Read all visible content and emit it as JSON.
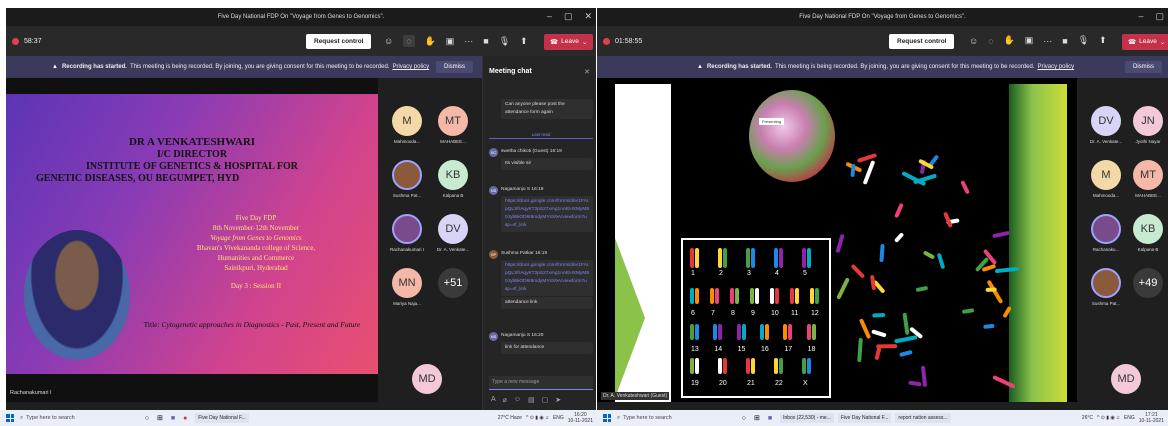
{
  "left": {
    "title": "Five Day National FDP On \"Voyage from Genes to Genomics\".",
    "timer": "58:37",
    "request_control": "Request control",
    "leave": "Leave",
    "banner": {
      "bold": "Recording has started.",
      "text": "This meeting is being recorded. By joining, you are giving consent for this meeting to be recorded.",
      "link": "Privacy policy",
      "dismiss": "Dismiss"
    },
    "slide": {
      "line1": "DR A VENKATESHWARI",
      "line2": "I/C DIRECTOR",
      "line3": "INSTITUTE OF GENETICS & HOSPITAL FOR",
      "line4": "GENETIC   DISEASES, OU BEGUMPET, HYD",
      "y1": "Five Day FDP",
      "y2": "8th November-12th November",
      "y3": "Voyage from Genes to Genomics",
      "y4": "Bhavan's Vivekananda college of Science,",
      "y5": "Humanities and Commerce",
      "y6": "Sainikpuri, Hyderabad",
      "y7": "Day 3 : Session II",
      "title_label": "Title:",
      "title_text": "Cytogenetic approaches in Diagnostics - Past, Present and Future"
    },
    "speaker": "Rachanakumari I",
    "participants": [
      {
        "initials": "M",
        "name": "Mahmooda...",
        "color": "#f4d9a8"
      },
      {
        "initials": "MT",
        "name": "MAHABEE...",
        "color": "#f3b8a8"
      },
      {
        "initials": "",
        "name": "Sushma Pat...",
        "color": "#8b5a3c"
      },
      {
        "initials": "KB",
        "name": "Kalpana B",
        "color": "#c7ead0"
      },
      {
        "initials": "",
        "name": "Rachanakumari I",
        "color": "#7a4b8a"
      },
      {
        "initials": "DV",
        "name": "Dr. A. Venkate...",
        "color": "#d8d4f5"
      },
      {
        "initials": "MN",
        "name": "Mariya Naja...",
        "color": "#f3b8a8"
      },
      {
        "initials": "+51",
        "name": "",
        "color": "#3a3a3a"
      },
      {
        "initials": "MD",
        "name": "",
        "color": "#f3c8d8"
      }
    ],
    "chat": {
      "header": "Meeting chat",
      "m0": "Can anyone please post the attendance form again",
      "last_read": "Last read",
      "m1_name": "swetha chikoti (Guest)",
      "m1_time": "16:19",
      "m1_text": "Its visible sir",
      "m2_name": "Nagamanju S",
      "m2_time": "16:19",
      "m2_link": "https://docs.google.com/forms/d/e/1FAIpQLSfrAqyKT2pS27xmg1nAEHXMyM80JybBiOD6I8mdyMYsX9A/viewform?usp=sf_link",
      "m3_name": "Sushma Patkar",
      "m3_time": "16:19",
      "m3_link": "https://docs.google.com/forms/d/e/1FAIpQLSfrAqyKT2pS27xmg1nAEHXMyM80JybBiOD6I8mdyMYsX9A/viewform?usp=sf_link",
      "m3_text": "attendance link",
      "m4_name": "Nagamanju S",
      "m4_time": "16:20",
      "m4_text": "link for attendance",
      "input_placeholder": "Type a new message"
    },
    "taskbar": {
      "search": "Type here to search",
      "app": "Five Day National F...",
      "weather": "27°C  Haze",
      "lang": "ENG",
      "time": "16:20",
      "date": "10-11-2021"
    }
  },
  "right": {
    "title": "Five Day National FDP On \"Voyage from Genes to Genomics\".",
    "timer": "01:58:55",
    "request_control": "Request control",
    "leave": "Leave",
    "banner": {
      "bold": "Recording has started.",
      "text": "This meeting is being recorded. By joining, you are giving consent for this meeting to be recorded.",
      "link": "Privacy policy",
      "dismiss": "Dismiss"
    },
    "presenting": "Presenting",
    "presenter_name": "Dr. A. Venkateshwari (Guest)",
    "karyotype_numbers": [
      "1",
      "2",
      "3",
      "4",
      "5",
      "6",
      "7",
      "8",
      "9",
      "10",
      "11",
      "12",
      "13",
      "14",
      "15",
      "16",
      "17",
      "18",
      "19",
      "20",
      "21",
      "22",
      "X"
    ],
    "participants": [
      {
        "initials": "DV",
        "name": "Dr. A. Venkate...",
        "color": "#d8d4f5"
      },
      {
        "initials": "JN",
        "name": "Jyothi Nayar",
        "color": "#f3c8d8"
      },
      {
        "initials": "M",
        "name": "Mahmooda...",
        "color": "#f4d9a8"
      },
      {
        "initials": "MT",
        "name": "MAHABEE...",
        "color": "#f3b8a8"
      },
      {
        "initials": "",
        "name": "Rachanaku...",
        "color": "#7a4b8a"
      },
      {
        "initials": "KB",
        "name": "Kalpana B",
        "color": "#c7ead0"
      },
      {
        "initials": "",
        "name": "Sushma Pat...",
        "color": "#8b5a3c"
      },
      {
        "initials": "+49",
        "name": "",
        "color": "#3a3a3a"
      },
      {
        "initials": "MD",
        "name": "",
        "color": "#f3c8d8"
      }
    ],
    "taskbar": {
      "search": "Type here to search",
      "app1": "Inbox (22,530) - me...",
      "app2": "Five Day National F...",
      "app3": "report nation assess...",
      "weather": "26°C",
      "lang": "ENG",
      "time": "17:21",
      "date": "10-11-2021"
    }
  }
}
